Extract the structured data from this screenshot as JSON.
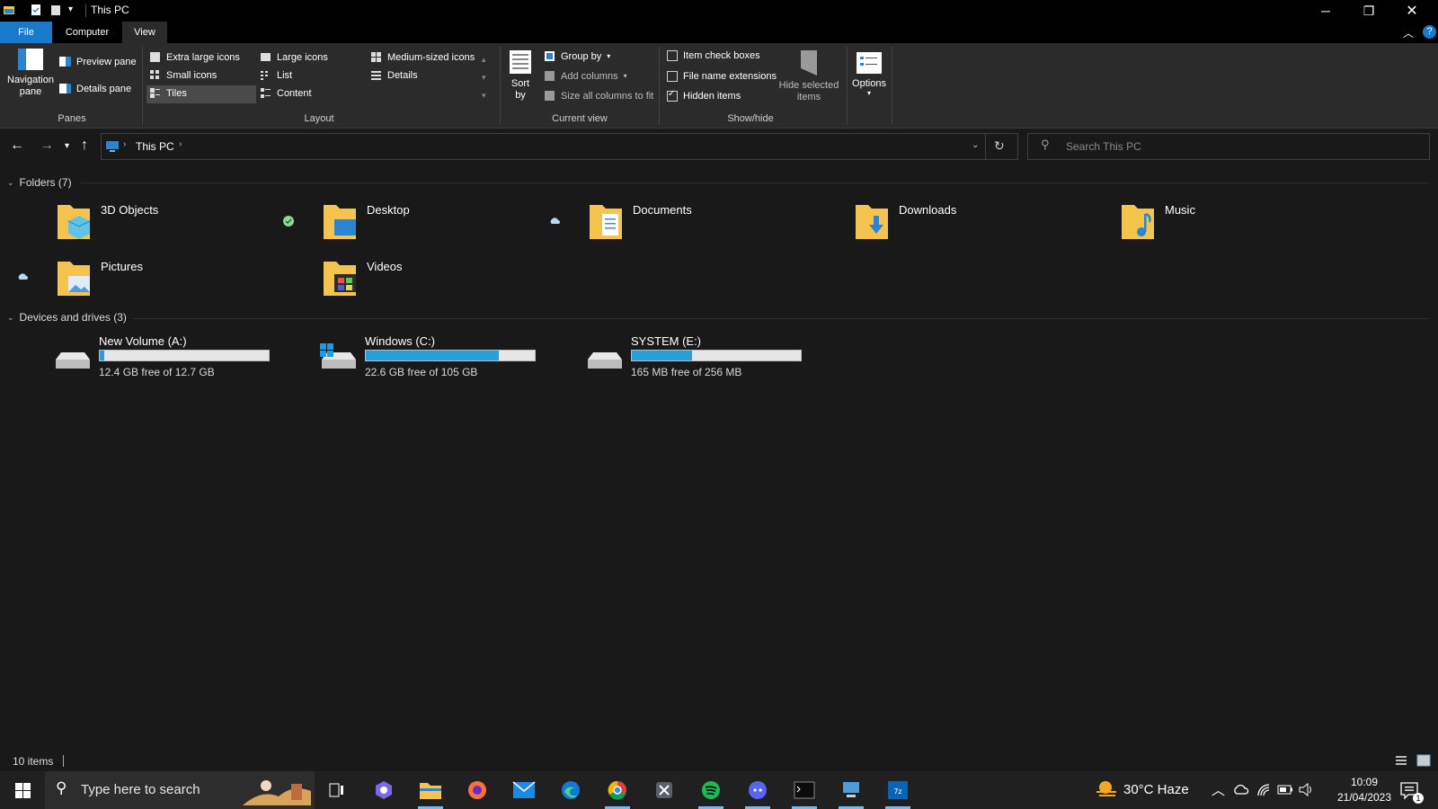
{
  "window": {
    "title": "This PC"
  },
  "tabs": [
    "File",
    "Computer",
    "View"
  ],
  "ribbon": {
    "panes": {
      "navigation_pane": "Navigation\npane",
      "preview_pane": "Preview pane",
      "details_pane": "Details pane",
      "group": "Panes"
    },
    "layout": {
      "options": [
        "Extra large icons",
        "Large icons",
        "Medium-sized icons",
        "Small icons",
        "List",
        "Details",
        "Tiles",
        "Content"
      ],
      "selected": "Tiles",
      "group": "Layout"
    },
    "current_view": {
      "sort_by": "Sort\nby",
      "group_by": "Group by",
      "add_columns": "Add columns",
      "size_all": "Size all columns to fit",
      "group": "Current view"
    },
    "show_hide": {
      "item_check_boxes": "Item check boxes",
      "file_name_extensions": "File name extensions",
      "hidden_items": "Hidden items",
      "item_check_boxes_checked": false,
      "file_name_extensions_checked": false,
      "hidden_items_checked": true,
      "hide_selected": "Hide selected\nitems",
      "group": "Show/hide"
    },
    "options": "Options"
  },
  "address": {
    "path": "This PC",
    "search_placeholder": "Search This PC"
  },
  "folders": {
    "header": "Folders (7)",
    "items": [
      "3D Objects",
      "Desktop",
      "Documents",
      "Downloads",
      "Music",
      "Pictures",
      "Videos"
    ]
  },
  "drives": {
    "header": "Devices and drives (3)",
    "items": [
      {
        "name": "New Volume (A:)",
        "free": "12.4 GB free of 12.7 GB",
        "used_fraction": 0.024
      },
      {
        "name": "Windows (C:)",
        "free": "22.6 GB free of 105 GB",
        "used_fraction": 0.785
      },
      {
        "name": "SYSTEM (E:)",
        "free": "165 MB free of 256 MB",
        "used_fraction": 0.355
      }
    ]
  },
  "status": {
    "item_count": "10 items"
  },
  "taskbar": {
    "search_placeholder": "Type here to search",
    "weather": "30°C  Haze",
    "time": "10:09",
    "date": "21/04/2023",
    "notification_count": "1"
  },
  "colors": {
    "accent": "#1979ca",
    "drive_bar": "#26a0da",
    "folder": "#f4c44e"
  }
}
